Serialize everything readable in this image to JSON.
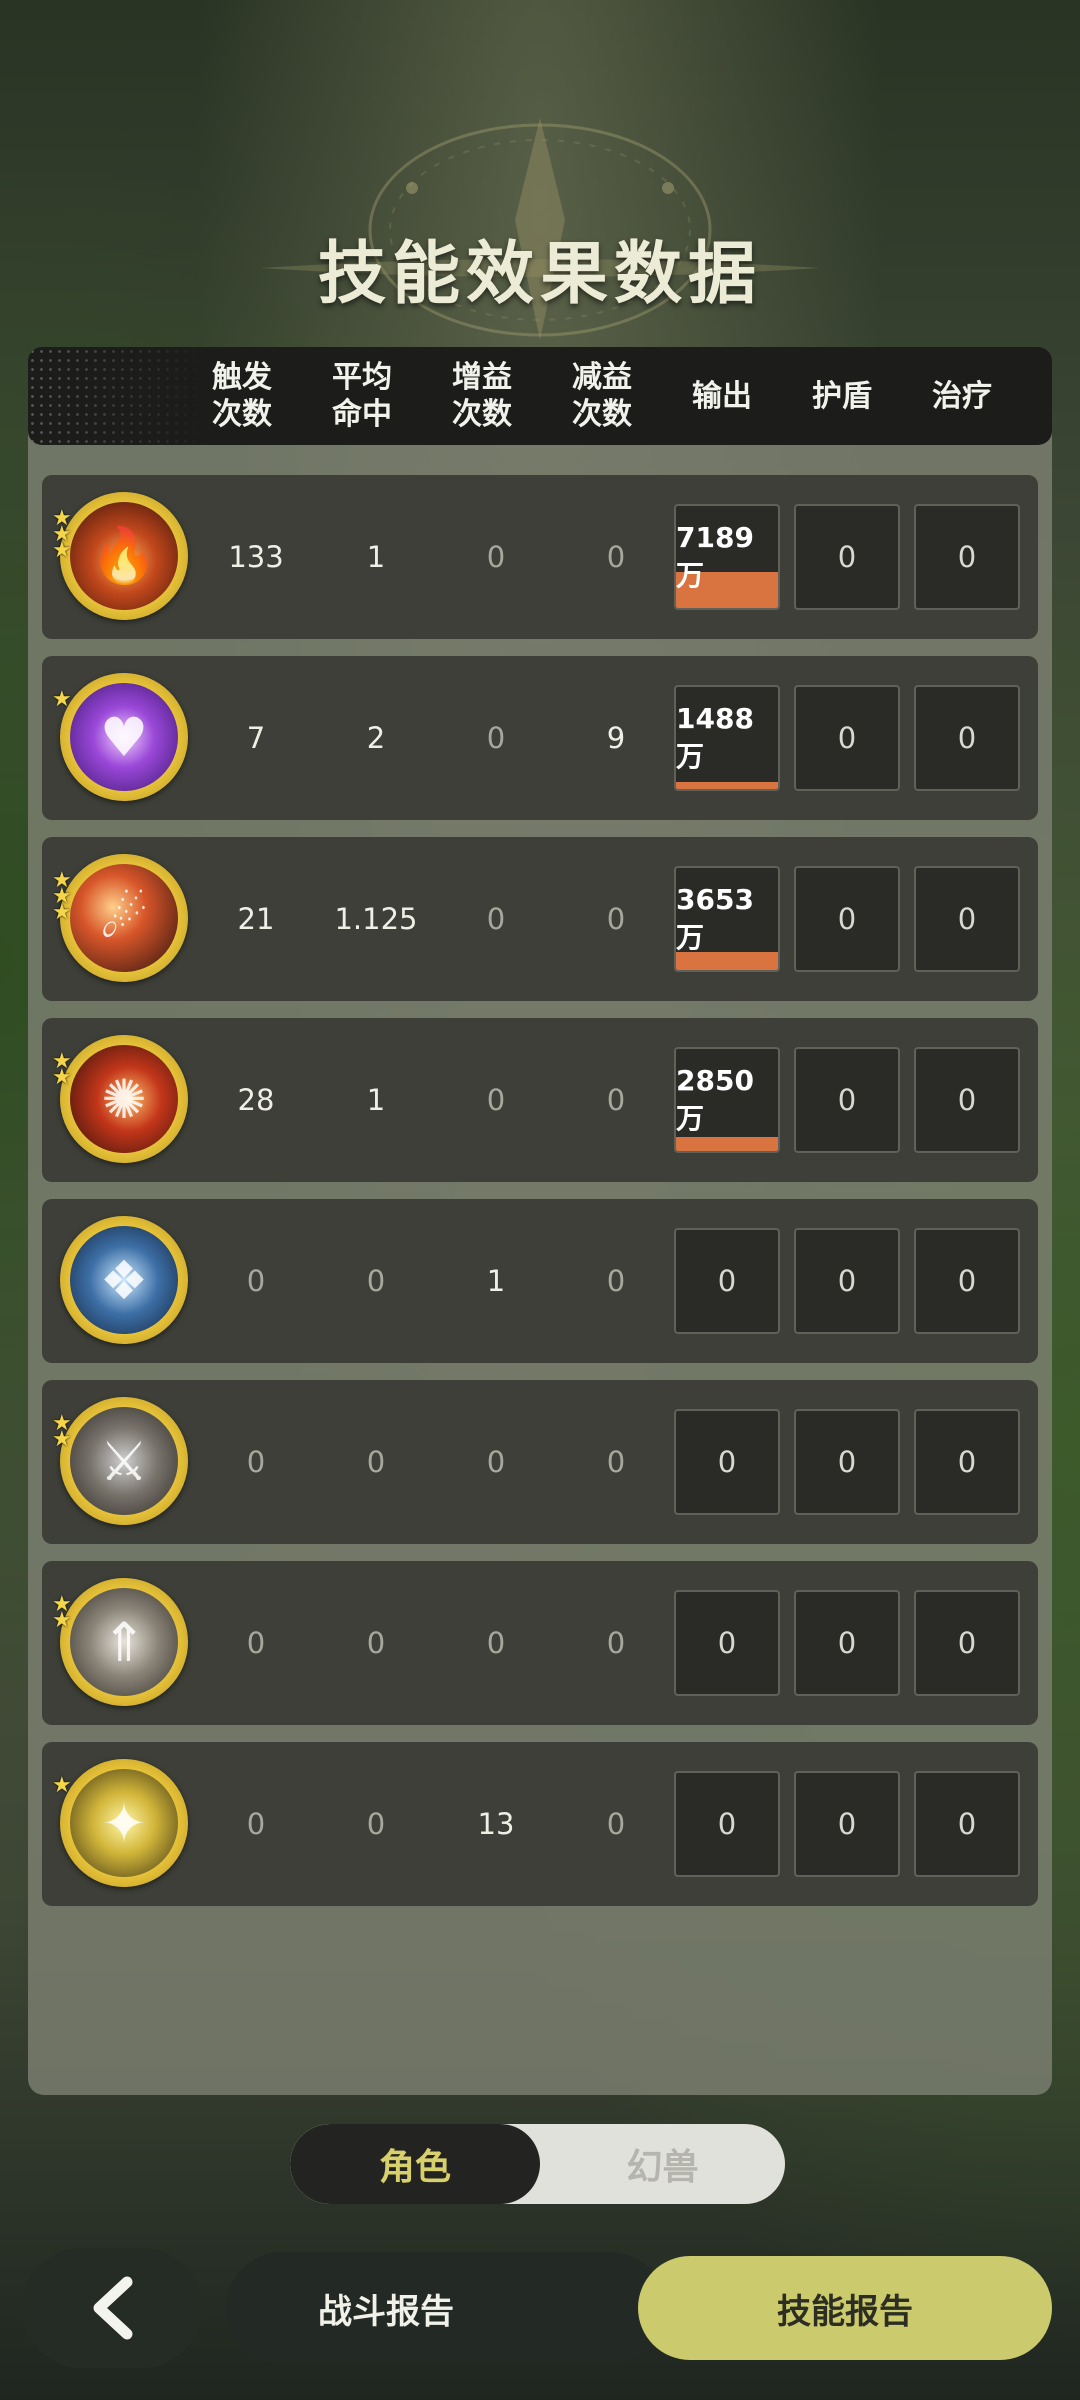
{
  "title": "技能效果数据",
  "columns": [
    "触发\n次数",
    "平均\n命中",
    "增益\n次数",
    "减益\n次数",
    "输出",
    "护盾",
    "治疗"
  ],
  "rows": [
    {
      "icon": "fire-swirl-skill-icon",
      "stars": 3,
      "trigger": "133",
      "avg_hit": "1",
      "buff": "0",
      "debuff": "0",
      "output": "7189万",
      "output_fill": 0.35,
      "shield": "0",
      "heal": "0"
    },
    {
      "icon": "purple-heart-orb-skill-icon",
      "stars": 1,
      "trigger": "7",
      "avg_hit": "2",
      "buff": "0",
      "debuff": "9",
      "output": "1488万",
      "output_fill": 0.07,
      "shield": "0",
      "heal": "0"
    },
    {
      "icon": "flame-slash-skill-icon",
      "stars": 3,
      "trigger": "21",
      "avg_hit": "1.125",
      "buff": "0",
      "debuff": "0",
      "output": "3653万",
      "output_fill": 0.18,
      "shield": "0",
      "heal": "0"
    },
    {
      "icon": "flame-wave-skill-icon",
      "stars": 2,
      "trigger": "28",
      "avg_hit": "1",
      "buff": "0",
      "debuff": "0",
      "output": "2850万",
      "output_fill": 0.14,
      "shield": "0",
      "heal": "0"
    },
    {
      "icon": "ice-crystal-skill-icon",
      "stars": 0,
      "trigger": "0",
      "avg_hit": "0",
      "buff": "1",
      "debuff": "0",
      "output": "0",
      "output_fill": 0,
      "shield": "0",
      "heal": "0"
    },
    {
      "icon": "shadow-warrior-skill-icon",
      "stars": 2,
      "trigger": "0",
      "avg_hit": "0",
      "buff": "0",
      "debuff": "0",
      "output": "0",
      "output_fill": 0,
      "shield": "0",
      "heal": "0"
    },
    {
      "icon": "sword-up-arrows-skill-icon",
      "stars": 2,
      "trigger": "0",
      "avg_hit": "0",
      "buff": "0",
      "debuff": "0",
      "output": "0",
      "output_fill": 0,
      "shield": "0",
      "heal": "0"
    },
    {
      "icon": "golden-spirit-skill-icon",
      "stars": 1,
      "trigger": "0",
      "avg_hit": "0",
      "buff": "13",
      "debuff": "0",
      "output": "0",
      "output_fill": 0,
      "shield": "0",
      "heal": "0"
    }
  ],
  "toggle": {
    "active": "角色",
    "inactive": "幻兽"
  },
  "bottom_bar": {
    "back_icon": "chevron-left-icon",
    "battle_report": "战斗报告",
    "skill_report": "技能报告"
  },
  "colors": {
    "output_bar": "#d9733f",
    "accent_button": "#cbca6c",
    "toggle_active_text": "#d8d06c"
  }
}
